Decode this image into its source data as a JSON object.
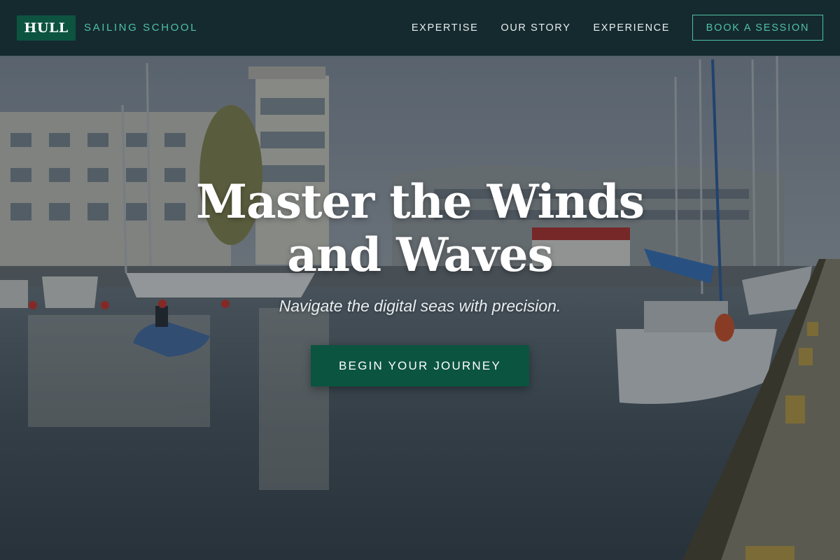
{
  "nav": {
    "brand_box": "HULL",
    "brand_sub": "SAILING SCHOOL",
    "links": [
      "EXPERTISE",
      "OUR STORY",
      "EXPERIENCE"
    ],
    "cta": "BOOK A SESSION"
  },
  "hero": {
    "title": "Master the Winds and Waves",
    "subtitle": "Navigate the digital seas with precision.",
    "cta": "BEGIN YOUR JOURNEY",
    "background": "harbor-marina-photo"
  },
  "colors": {
    "nav_bg": "#152a2e",
    "brand_green": "#0c5440",
    "accent_teal": "#4fc1a6",
    "cta_green": "#0b5440"
  }
}
